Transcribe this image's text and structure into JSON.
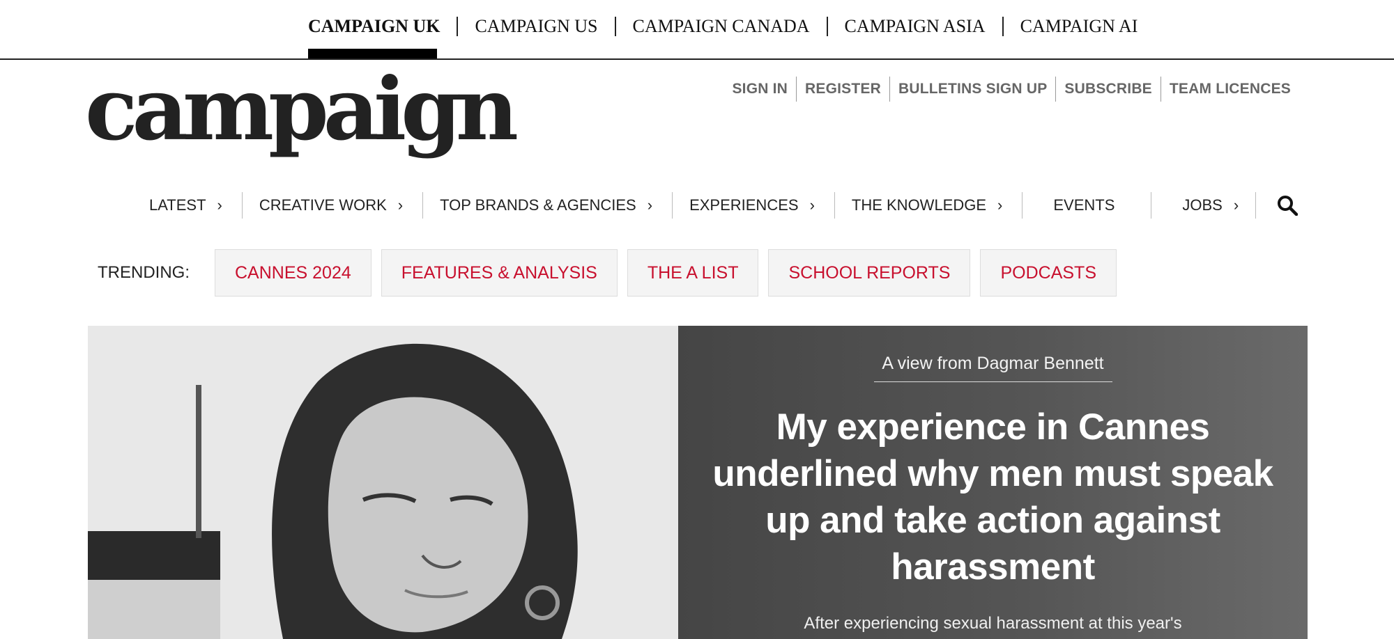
{
  "editions": [
    {
      "label": "CAMPAIGN UK",
      "active": true
    },
    {
      "label": "CAMPAIGN US",
      "active": false
    },
    {
      "label": "CAMPAIGN CANADA",
      "active": false
    },
    {
      "label": "CAMPAIGN ASIA",
      "active": false
    },
    {
      "label": "CAMPAIGN AI",
      "active": false
    }
  ],
  "logo": "campaign",
  "account": [
    "SIGN IN",
    "REGISTER",
    "BULLETINS SIGN UP",
    "SUBSCRIBE",
    "TEAM LICENCES"
  ],
  "nav": [
    {
      "label": "LATEST",
      "chevron": true
    },
    {
      "label": "CREATIVE WORK",
      "chevron": true
    },
    {
      "label": "TOP BRANDS & AGENCIES",
      "chevron": true
    },
    {
      "label": "EXPERIENCES",
      "chevron": true
    },
    {
      "label": "THE KNOWLEDGE",
      "chevron": true
    },
    {
      "label": "EVENTS",
      "chevron": false
    },
    {
      "label": "JOBS",
      "chevron": true
    }
  ],
  "search_icon": "search-icon",
  "trending": {
    "label": "TRENDING:",
    "items": [
      "CANNES 2024",
      "FEATURES & ANALYSIS",
      "THE A LIST",
      "SCHOOL REPORTS",
      "PODCASTS"
    ]
  },
  "hero": {
    "byline": "A view from Dagmar Bennett",
    "headline": "My experience in Cannes underlined why men must speak up and take action against harassment",
    "standfirst": "After experiencing sexual harassment at this year's"
  },
  "colors": {
    "accent": "#c8102e",
    "panel": "#4d4d4d"
  }
}
